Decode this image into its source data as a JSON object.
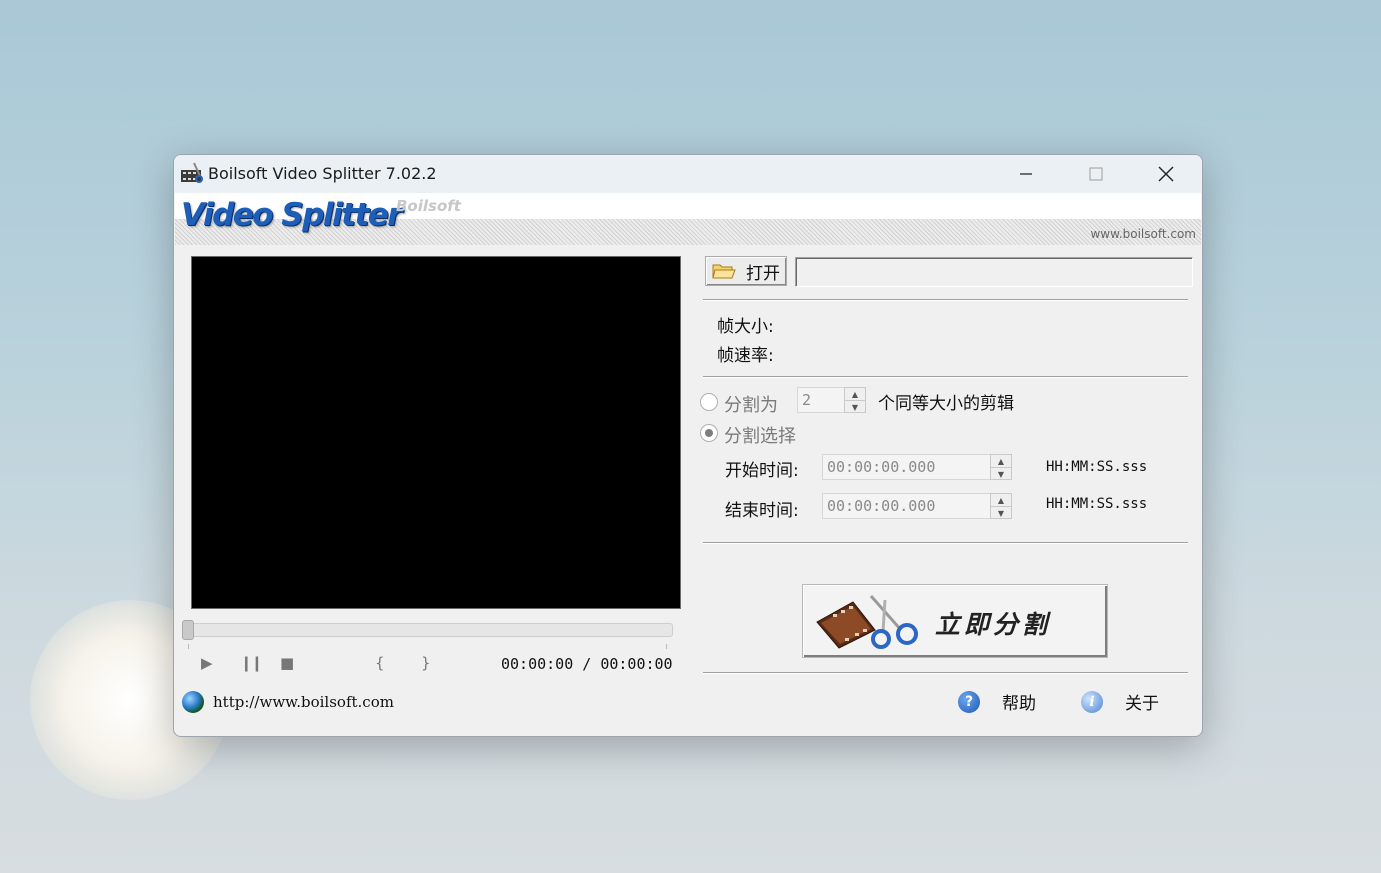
{
  "window": {
    "title": "Boilsoft Video Splitter 7.02.2",
    "icons": {
      "app": "film-scissors-icon",
      "minimize": "minimize-icon",
      "maximize": "maximize-icon",
      "close": "close-icon"
    }
  },
  "banner": {
    "logo": "Video Splitter",
    "brand": "Boilsoft",
    "site": "www.boilsoft.com"
  },
  "player": {
    "time": "00:00:00 / 00:00:00",
    "seek_position": 0,
    "controls": {
      "play": "▶",
      "pause": "⏸",
      "stop": "■",
      "mark_start": "{",
      "mark_end": "}"
    },
    "url": "http://www.boilsoft.com"
  },
  "file": {
    "open_label": "打开",
    "path": ""
  },
  "info": {
    "frame_size_label": "帧大小:",
    "frame_rate_label": "帧速率:"
  },
  "split": {
    "equal_label": "分割为",
    "equal_count": "2",
    "equal_suffix": "个同等大小的剪辑",
    "select_label": "分割选择",
    "selected_mode": "select",
    "start_label": "开始时间:",
    "start_value": "00:00:00.000",
    "end_label": "结束时间:",
    "end_value": "00:00:00.000",
    "time_format": "HH:MM:SS.sss",
    "split_now_label": "立即分割"
  },
  "footer": {
    "help_label": "帮助",
    "about_label": "关于"
  },
  "colors": {
    "window_bg": "#f0f0f0",
    "titlebar_bg": "#eaf0f3",
    "logo_blue": "#1d5fb8",
    "video_bg": "#000000"
  }
}
